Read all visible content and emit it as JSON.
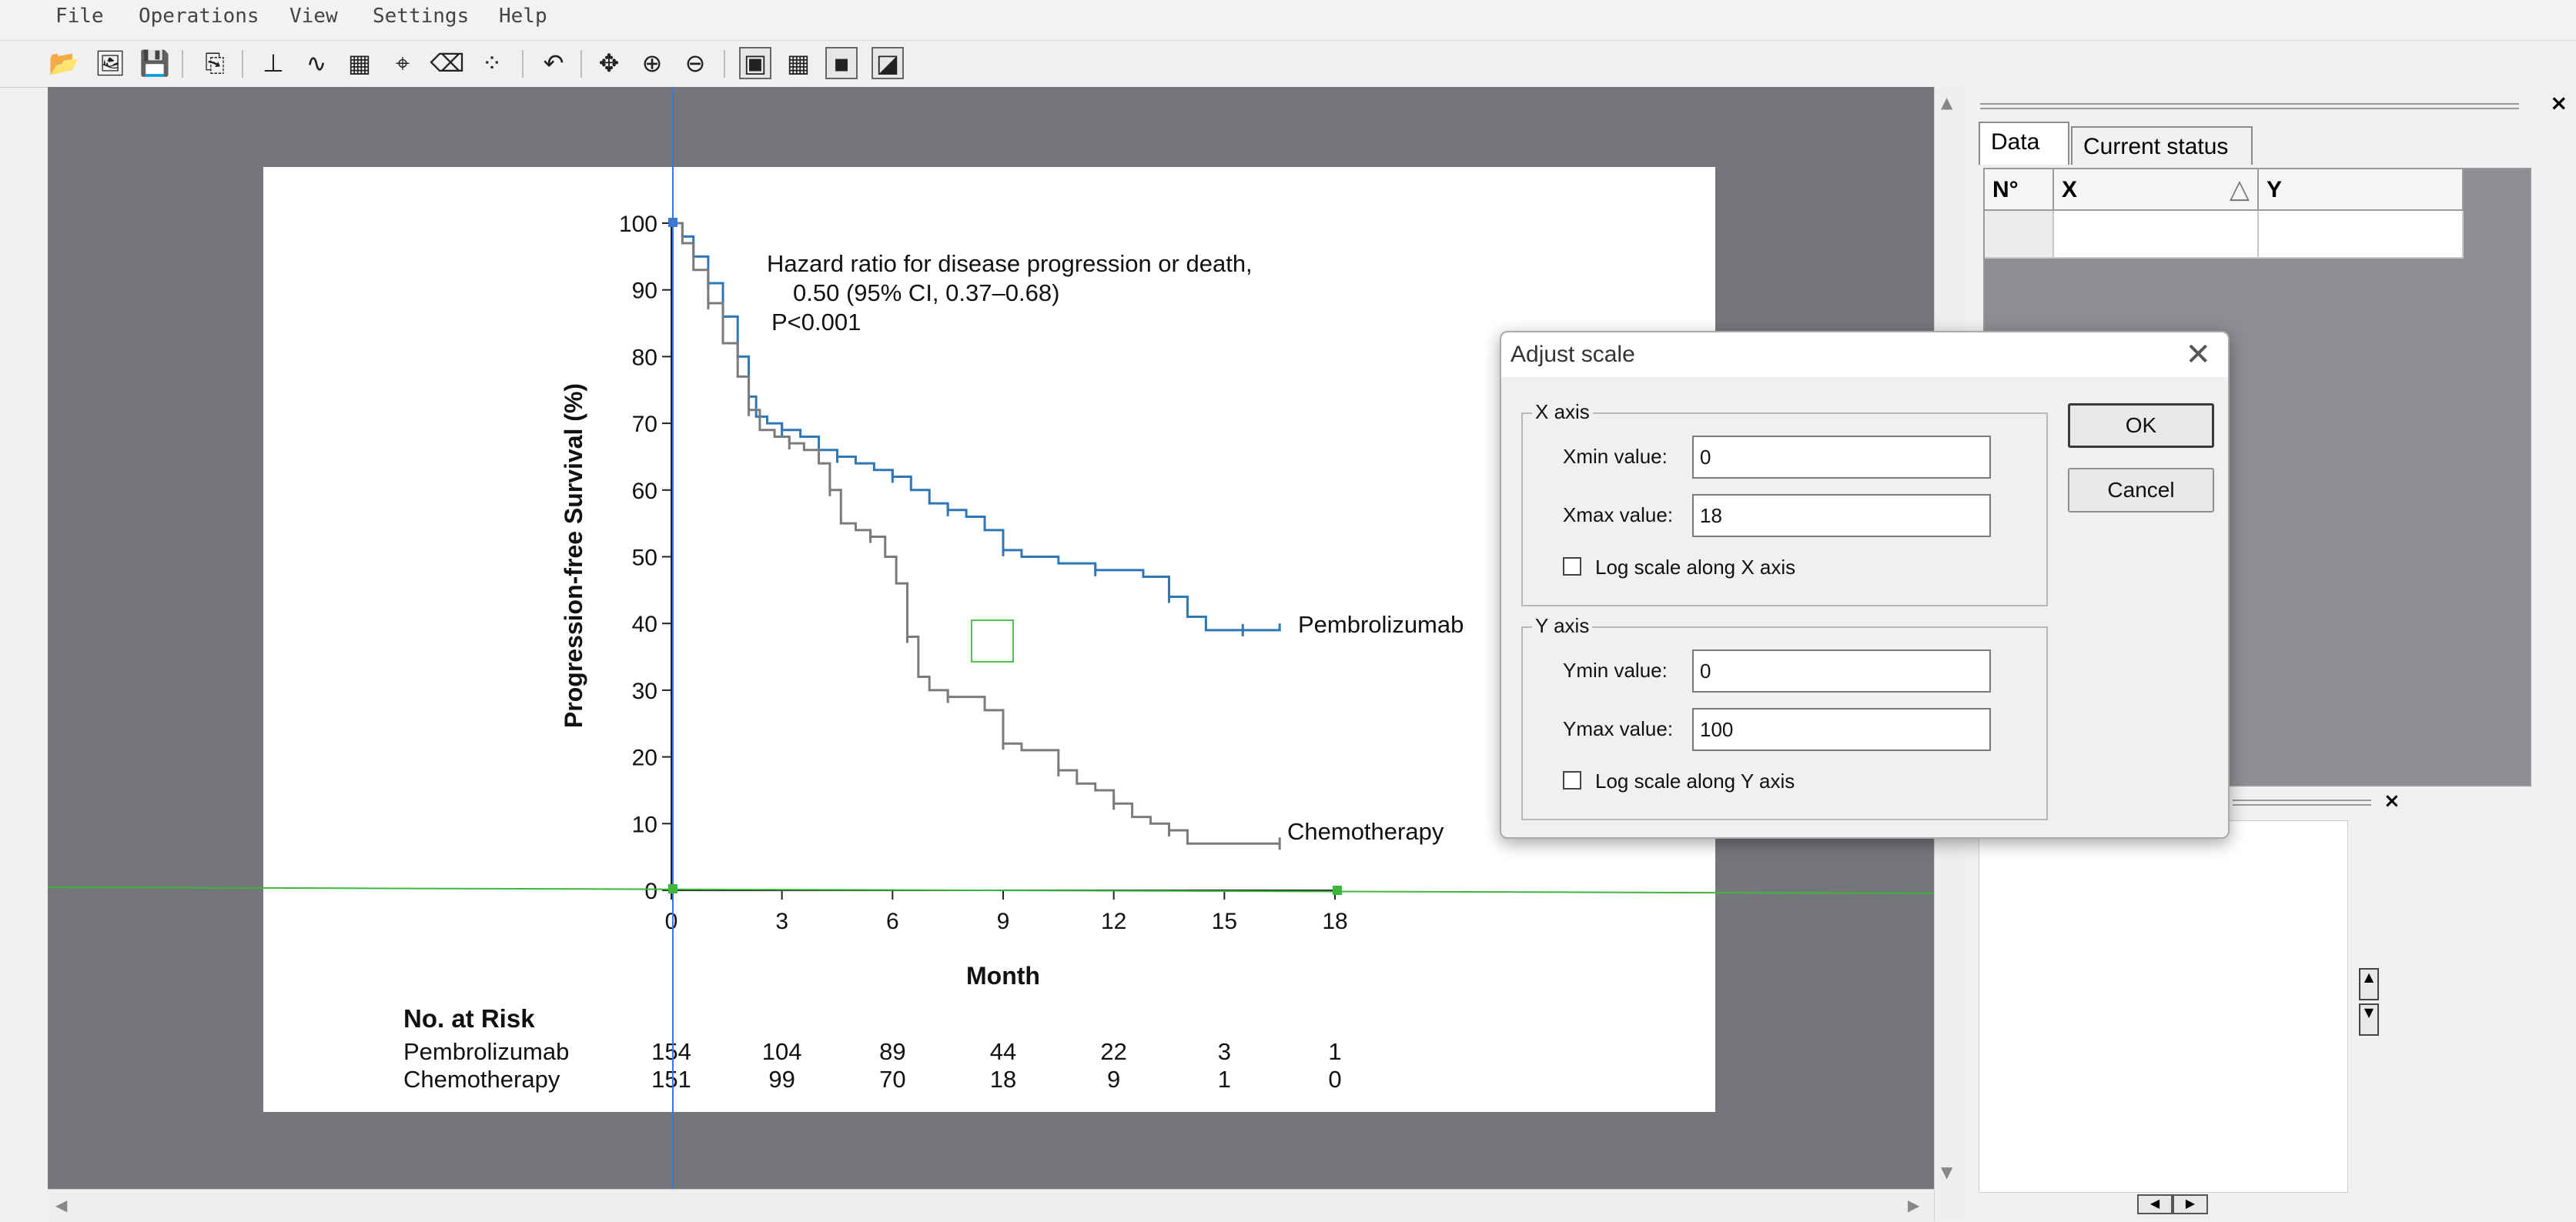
{
  "menu": {
    "items": [
      "File",
      "Operations",
      "View",
      "Settings",
      "Help"
    ]
  },
  "toolbar": {
    "icons": [
      "open-folder-icon",
      "open-image-icon",
      "save-icon",
      "copy-icon",
      "axis-tool-icon",
      "curve-tool-icon",
      "area-tool-icon",
      "point-tool-icon",
      "eraser-icon",
      "scatter-tool-icon",
      "undo-icon",
      "pan-icon",
      "zoom-in-icon",
      "zoom-out-icon",
      "show-image-icon",
      "show-grid-icon",
      "show-points-icon",
      "show-curve-icon"
    ],
    "glyphs": [
      "📂",
      "🖼",
      "💾",
      "⎘",
      "⊥",
      "∿",
      "▦",
      "⌖",
      "⌫",
      "⁘",
      "↶",
      "✥",
      "⊕",
      "⊖",
      "▣",
      "▦",
      "▪",
      "◪"
    ]
  },
  "colors": {
    "workspace": "#75767b",
    "pembrolizumab": "#2f77b6",
    "chemotherapy": "#7b7b7b",
    "axis_marker_v": "#3a78d8",
    "axis_marker_h": "#3db63d"
  },
  "plot": {
    "hazard_line1": "Hazard ratio for disease progression or death,",
    "hazard_line2": "0.50 (95% CI, 0.37–0.68)",
    "hazard_line3": "P<0.001",
    "ylabel": "Progression-free Survival (%)",
    "xlabel": "Month",
    "y_ticks": [
      "100",
      "90",
      "80",
      "70",
      "60",
      "50",
      "40",
      "30",
      "20",
      "10",
      "0"
    ],
    "x_ticks": [
      "0",
      "3",
      "6",
      "9",
      "12",
      "15",
      "18"
    ],
    "label_pembro": "Pembrolizumab",
    "label_chemo": "Chemotherapy",
    "risk_title": "No. at Risk",
    "risk_rows": [
      {
        "name": "Pembrolizumab",
        "values": [
          "154",
          "104",
          "89",
          "44",
          "22",
          "3",
          "1"
        ]
      },
      {
        "name": "Chemotherapy",
        "values": [
          "151",
          "99",
          "70",
          "18",
          "9",
          "1",
          "0"
        ]
      }
    ]
  },
  "chart_data": {
    "type": "line",
    "title": "",
    "xlabel": "Month",
    "ylabel": "Progression-free Survival (%)",
    "xlim": [
      0,
      18
    ],
    "ylim": [
      0,
      100
    ],
    "x_ticks": [
      0,
      3,
      6,
      9,
      12,
      15,
      18
    ],
    "y_ticks": [
      0,
      10,
      20,
      30,
      40,
      50,
      60,
      70,
      80,
      90,
      100
    ],
    "grid": false,
    "legend": "none",
    "series": [
      {
        "name": "Pembrolizumab",
        "step": true,
        "x": [
          0,
          0.3,
          0.6,
          1.0,
          1.4,
          1.8,
          2.1,
          2.3,
          2.6,
          3.0,
          3.5,
          4.0,
          4.5,
          5.0,
          5.5,
          6.0,
          6.5,
          7.0,
          7.5,
          8.0,
          8.5,
          9.0,
          9.5,
          10.5,
          11.5,
          12.0,
          12.8,
          13.5,
          14.0,
          14.5,
          15.5,
          16.5
        ],
        "y": [
          100,
          98,
          95,
          91,
          86,
          80,
          74,
          71,
          70,
          69,
          68,
          66,
          65,
          64,
          63,
          62,
          60,
          58,
          57,
          56,
          54,
          51,
          50,
          49,
          48,
          48,
          47,
          44,
          41,
          39,
          39,
          40
        ]
      },
      {
        "name": "Chemotherapy",
        "step": true,
        "x": [
          0,
          0.3,
          0.6,
          1.0,
          1.4,
          1.8,
          2.1,
          2.4,
          2.8,
          3.2,
          3.6,
          4.0,
          4.3,
          4.6,
          5.0,
          5.4,
          5.8,
          6.1,
          6.4,
          6.7,
          7.0,
          7.5,
          8.0,
          8.5,
          9.0,
          9.5,
          10.0,
          10.5,
          11.0,
          11.5,
          12.0,
          12.5,
          13.0,
          13.5,
          14.0,
          15.0,
          16.5
        ],
        "y": [
          100,
          97,
          93,
          88,
          82,
          77,
          72,
          69,
          68,
          67,
          66,
          64,
          60,
          55,
          54,
          53,
          50,
          46,
          38,
          32,
          30,
          29,
          29,
          27,
          22,
          21,
          21,
          18,
          16,
          15,
          13,
          11,
          10,
          9,
          7,
          7,
          7
        ]
      }
    ]
  },
  "right_panel": {
    "tabs": [
      "Data",
      "Current status"
    ],
    "columns": [
      "N°",
      "X",
      "Y"
    ],
    "sort_icon": "△"
  },
  "dialog": {
    "title": "Adjust scale",
    "close": "✕",
    "x_axis": {
      "label": "X axis",
      "min_label": "Xmin value:",
      "min_value": "0",
      "max_label": "Xmax value:",
      "max_value": "18",
      "log_label": "Log scale along X axis"
    },
    "y_axis": {
      "label": "Y axis",
      "min_label": "Ymin value:",
      "min_value": "0",
      "max_label": "Ymax value:",
      "max_value": "100",
      "log_label": "Log scale along Y axis"
    },
    "ok": "OK",
    "cancel": "Cancel"
  }
}
